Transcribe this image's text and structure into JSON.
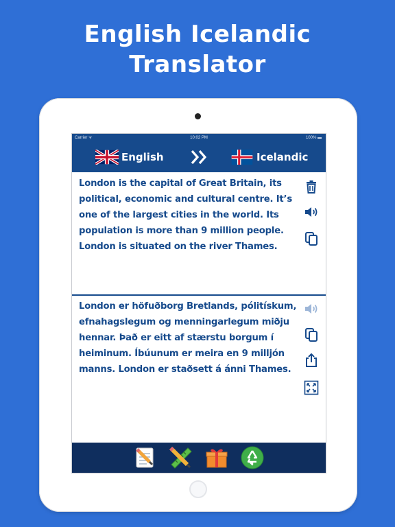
{
  "headline": {
    "line1": "English Icelandic",
    "line2": "Translator"
  },
  "status": {
    "carrier": "Carrier ᯤ",
    "time": "10:02 PM",
    "battery": "100% ▬"
  },
  "languages": {
    "source": "English",
    "target": "Icelandic"
  },
  "input_text": "London is the capital of Great Britain, its political, economic and cultural centre. It’s one of the largest cities in the world. Its population is more than 9 million people. London is situated on the river Thames.",
  "output_text": "London er höfuðborg Bretlands, pólitískum, efnahagslegum og menningarlegum miðju hennar. Það er eitt af stærstu borgum í heiminum. Íbúunum er meira en 9 milljón manns. London er staðsett á ánni Thames.",
  "icons": {
    "input_tools": [
      "trash-icon",
      "speaker-icon",
      "copy-icon"
    ],
    "output_tools": [
      "speaker-icon",
      "copy-icon",
      "share-icon",
      "fullscreen-icon"
    ],
    "bottom_bar": [
      "notepad-pencil-icon",
      "ruler-pencil-icon",
      "gift-icon",
      "recycle-icon"
    ]
  },
  "colors": {
    "background": "#2f6fd6",
    "app_bar": "#164a8c",
    "bottom_bar": "#0f2e5e",
    "text": "#164a8c"
  }
}
